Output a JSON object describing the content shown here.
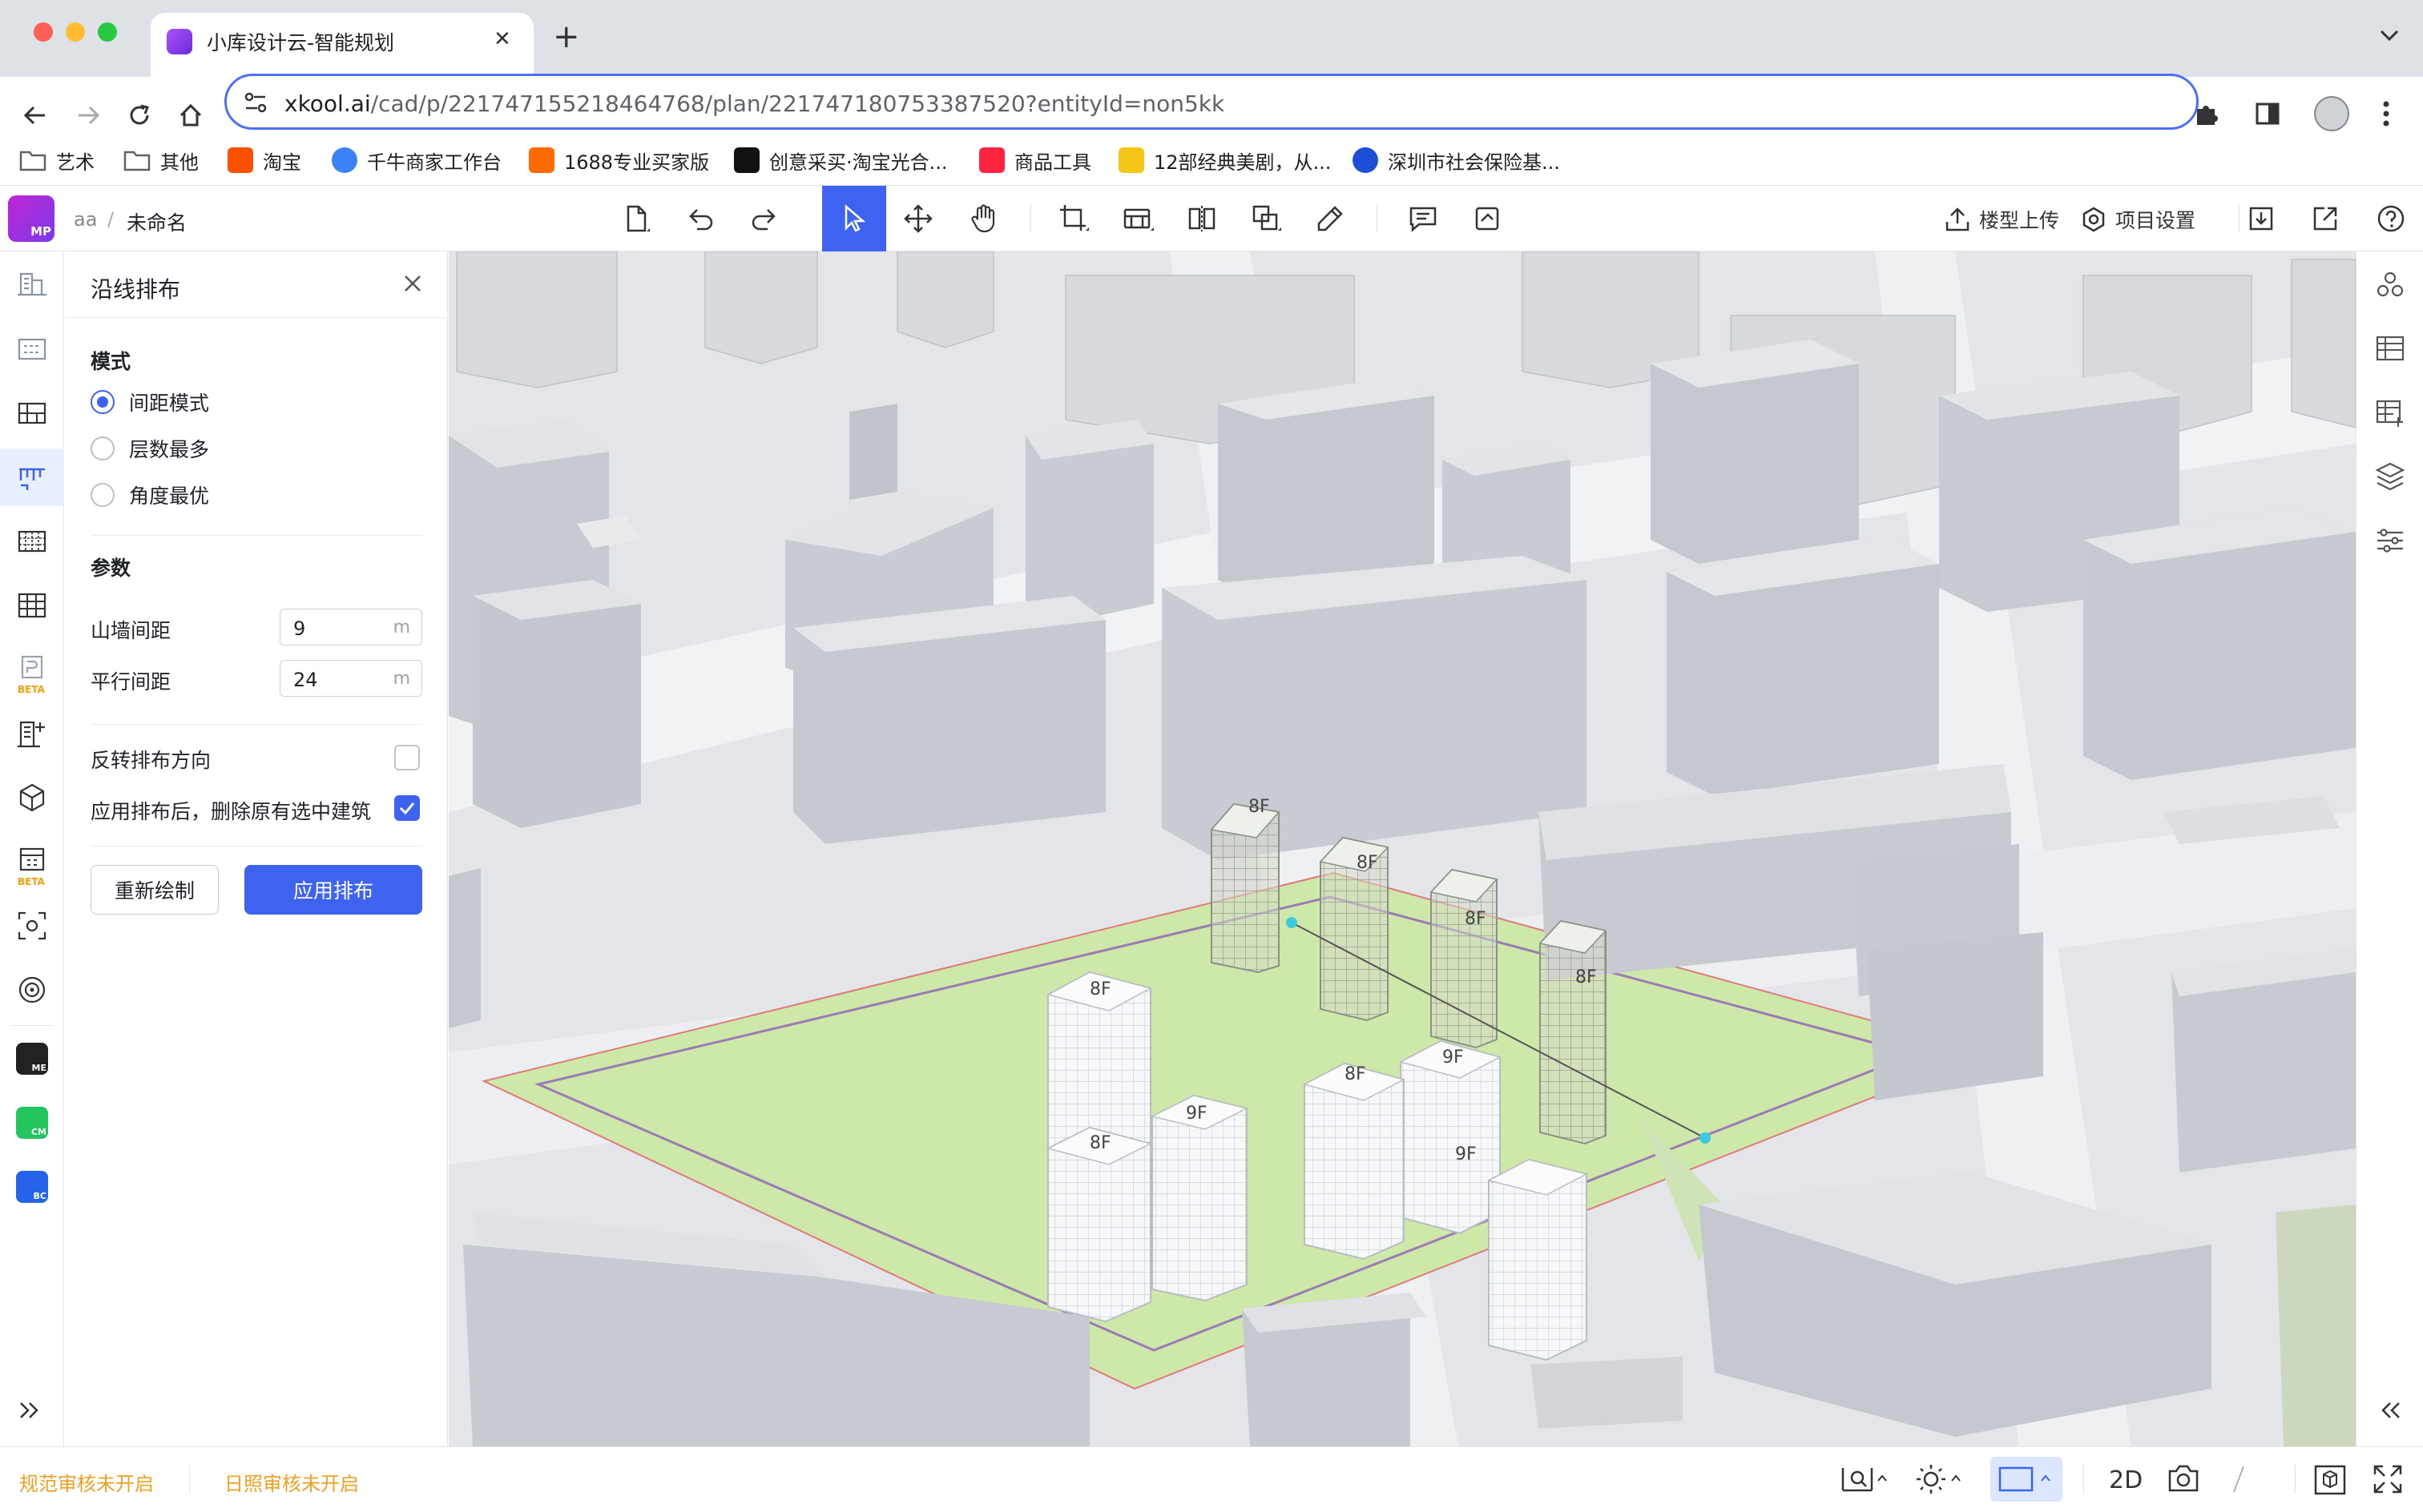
{
  "browser": {
    "tab_title": "小库设计云-智能规划",
    "url_host": "xkool.ai",
    "url_path": "/cad/p/221747155218464768/plan/221747180753387520?entityId=non5kk",
    "bookmarks": [
      {
        "label": "艺术",
        "icon": "folder-icon",
        "color": "#5f6368"
      },
      {
        "label": "其他",
        "icon": "folder-icon",
        "color": "#5f6368"
      },
      {
        "label": "淘宝",
        "icon": "taobao-icon",
        "color": "#ff5000"
      },
      {
        "label": "千牛商家工作台",
        "icon": "qianniu-icon",
        "color": "#3b82f6"
      },
      {
        "label": "1688专业买家版",
        "icon": "1688-icon",
        "color": "#ff6a00"
      },
      {
        "label": "创意采买·淘宝光合...",
        "icon": "guanghe-icon",
        "color": "#111111"
      },
      {
        "label": "商品工具",
        "icon": "xiaohongshu-icon",
        "color": "#ff2442"
      },
      {
        "label": "12部经典美剧，从...",
        "icon": "bookmark-icon",
        "color": "#f5c518"
      },
      {
        "label": "深圳市社会保险基...",
        "icon": "globe-icon",
        "color": "#1d4ed8"
      }
    ]
  },
  "header": {
    "breadcrumb_project": "aa",
    "breadcrumb_sep": "/",
    "breadcrumb_plan": "未命名",
    "logo_text": "MP",
    "upload_label": "楼型上传",
    "settings_label": "项目设置"
  },
  "panel": {
    "title": "沿线排布",
    "mode_heading": "模式",
    "modes": [
      {
        "label": "间距模式",
        "selected": true
      },
      {
        "label": "层数最多",
        "selected": false
      },
      {
        "label": "角度最优",
        "selected": false
      }
    ],
    "params_heading": "参数",
    "gable_spacing_label": "山墙间距",
    "gable_spacing_value": "9",
    "parallel_spacing_label": "平行间距",
    "parallel_spacing_value": "24",
    "unit": "m",
    "reverse_label": "反转排布方向",
    "reverse_checked": false,
    "delete_label": "应用排布后，删除原有选中建筑",
    "delete_checked": true,
    "redraw_button": "重新绘制",
    "apply_button": "应用排布"
  },
  "buildings": [
    {
      "floors": "8F",
      "type": "wireframe"
    },
    {
      "floors": "8F",
      "type": "wireframe"
    },
    {
      "floors": "8F",
      "type": "wireframe"
    },
    {
      "floors": "8F",
      "type": "wireframe"
    },
    {
      "floors": "8F",
      "type": "solid"
    },
    {
      "floors": "9F",
      "type": "solid"
    },
    {
      "floors": "8F",
      "type": "solid"
    },
    {
      "floors": "9F",
      "type": "solid"
    },
    {
      "floors": "8F",
      "type": "solid"
    },
    {
      "floors": "9F",
      "type": "solid"
    }
  ],
  "status": {
    "code_check": "规范审核未开启",
    "sun_check": "日照审核未开启",
    "view_mode": "2D"
  },
  "colors": {
    "accent": "#3d63f0",
    "site": "#cde8a8",
    "warning": "#f0a020"
  }
}
